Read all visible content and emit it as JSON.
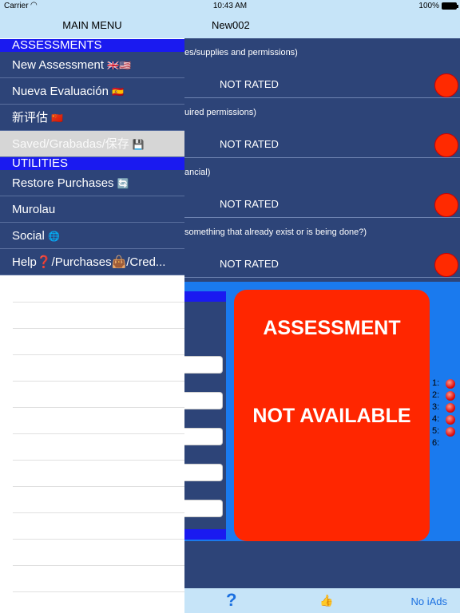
{
  "status": {
    "carrier": "Carrier",
    "wifi_icon": "wifi-icon",
    "time": "10:43 AM",
    "battery": "100%"
  },
  "nav": {
    "title": "New002"
  },
  "menu": {
    "title": "MAIN MENU",
    "sections": {
      "assessments": "ASSESSMENTS",
      "utilities": "UTILITIES"
    },
    "items": [
      {
        "label": "New Assessment",
        "icon": "🇬🇧🇺🇸"
      },
      {
        "label": "Nueva Evaluación",
        "icon": "🇪🇸"
      },
      {
        "label": "新评估",
        "icon": "🇨🇳"
      },
      {
        "label": "Saved/Grabadas/保存",
        "icon": "💾"
      },
      {
        "label": "Restore Purchases",
        "icon": "🔄"
      },
      {
        "label": "Murolau",
        "icon": ""
      },
      {
        "label": "Social",
        "icon": "🌐"
      },
      {
        "label": "Help❓/Purchases👜/Cred...",
        "icon": ""
      }
    ]
  },
  "questions": [
    {
      "text": "es/supplies and permissions)",
      "rating": "NOT RATED"
    },
    {
      "text": "uired permissions)",
      "rating": "NOT RATED"
    },
    {
      "text": "ancial)",
      "rating": "NOT RATED"
    },
    {
      "text": "something that already exist or is being done?)",
      "rating": "NOT RATED"
    }
  ],
  "card": {
    "line1": "ASSESSMENT",
    "line2": "NOT AVAILABLE"
  },
  "legend": [
    "1:",
    "2:",
    "3:",
    "4:",
    "5:",
    "6:"
  ],
  "toolbar": {
    "help": "?",
    "like": "👍",
    "no_ads": "No iAds"
  },
  "colors": {
    "menu_bg": "#2d4478",
    "section_bg": "#1a1af0",
    "bar_bg": "#c6e4f8",
    "alert_red": "#ff2600",
    "accent_blue": "#1a7aee"
  }
}
